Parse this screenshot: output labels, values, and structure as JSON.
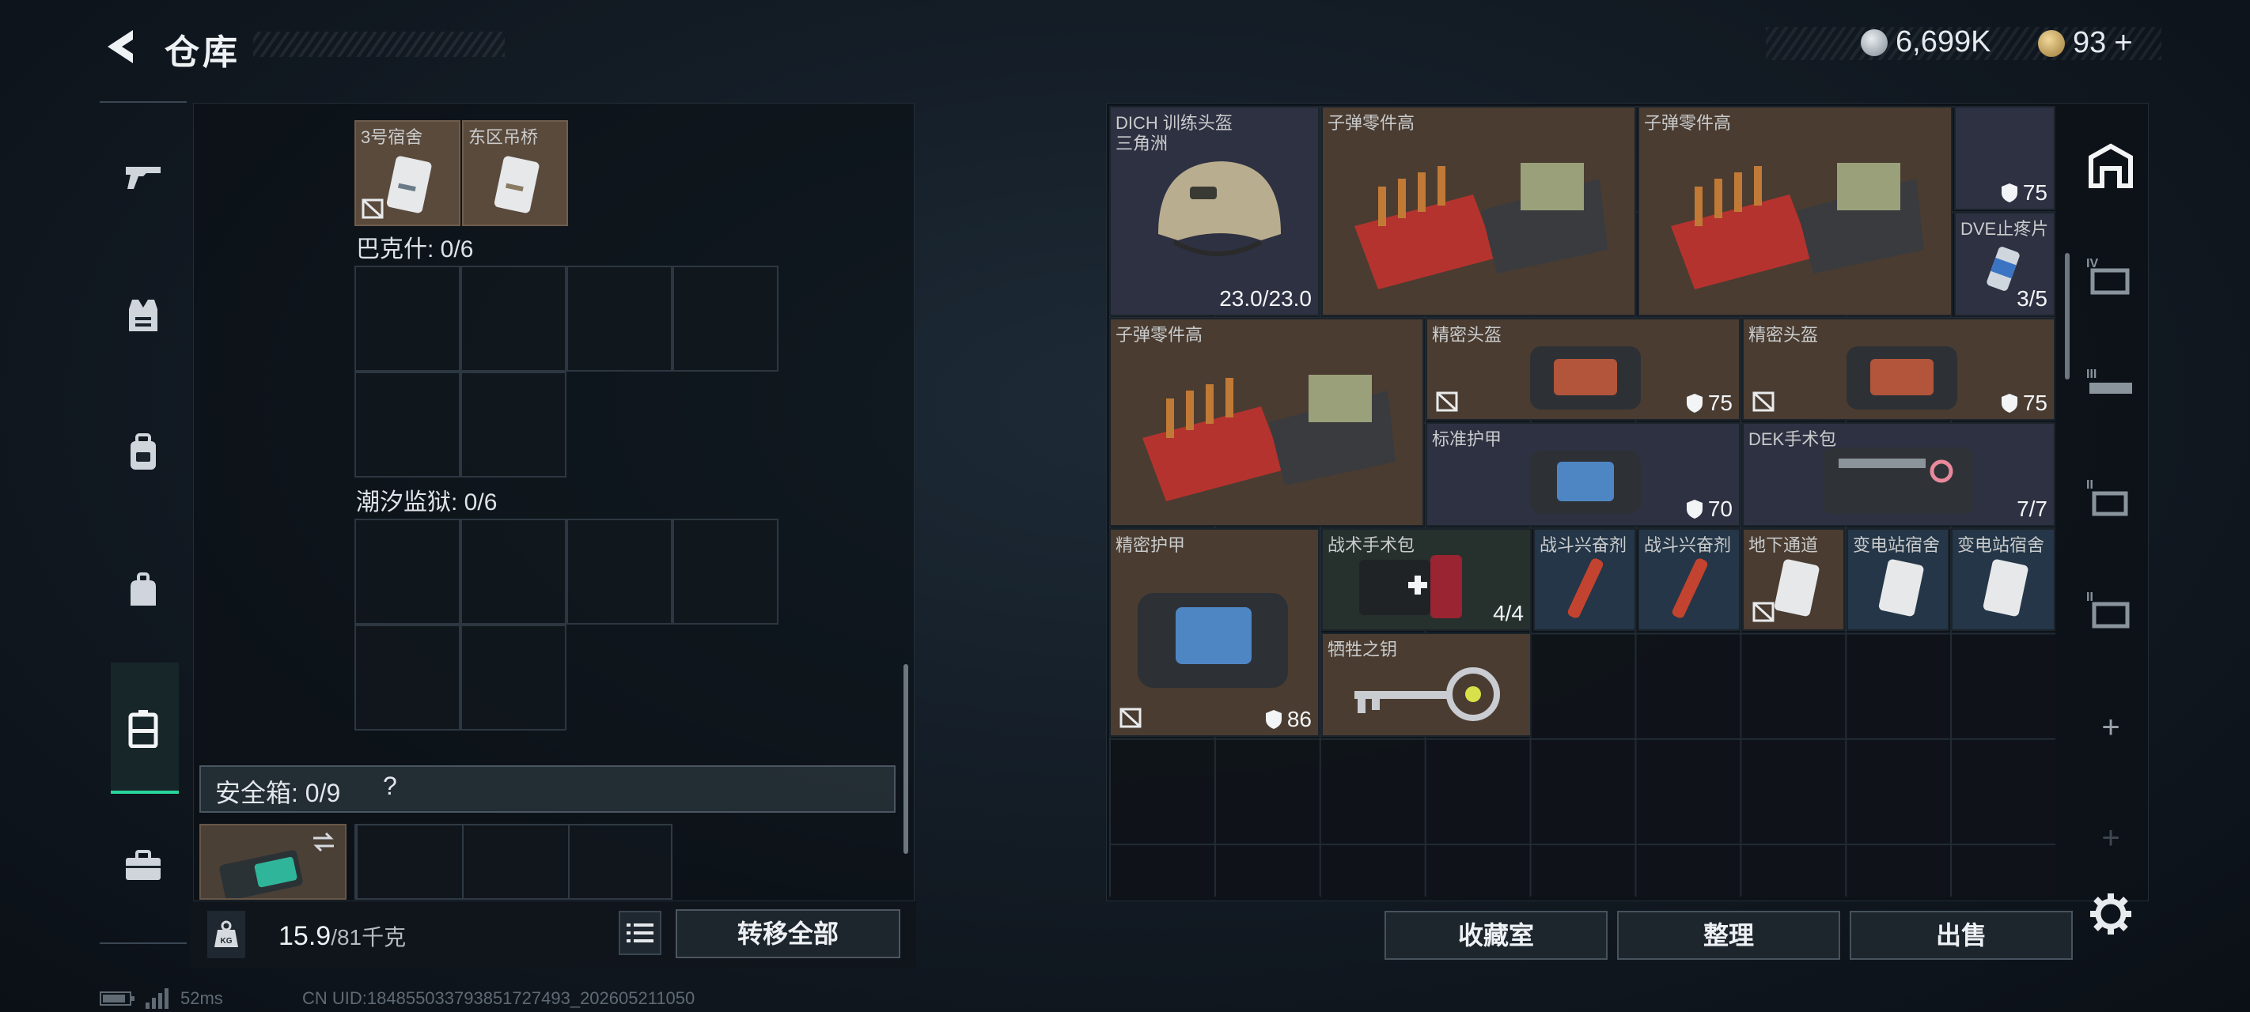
{
  "header": {
    "title": "仓库",
    "currency_main": "6,699K",
    "currency_premium": "93"
  },
  "left_nav": {
    "items": [
      "weapon-icon",
      "armor-vest-icon",
      "backpack-icon",
      "bag-icon",
      "safe-case-icon",
      "toolbox-icon"
    ],
    "active": "safe-case-icon"
  },
  "backpack": {
    "top_items": [
      {
        "name": "3号宿舍"
      },
      {
        "name": "东区吊桥"
      }
    ],
    "section_1": "巴克什: 0/6",
    "section_2": "潮汐监狱: 0/6",
    "safebox_label": "安全箱: 0/9",
    "safebox_help": "?",
    "weight_value": "15.9",
    "weight_cap": "/81千克",
    "transfer_all": "转移全部"
  },
  "storage": {
    "items": [
      {
        "name": "DICH 训练头盔",
        "sub": "三角洲",
        "value": "23.0/23.0"
      },
      {
        "name": "子弹零件高",
        "value": ""
      },
      {
        "name": "子弹零件高",
        "value": ""
      },
      {
        "name": "",
        "value": "75"
      },
      {
        "name": "DVE止疼片",
        "value": "3/5"
      },
      {
        "name": "子弹零件高",
        "value": ""
      },
      {
        "name": "精密头盔",
        "value": "75"
      },
      {
        "name": "精密头盔",
        "value": "75"
      },
      {
        "name": "标准护甲",
        "value": "70"
      },
      {
        "name": "DEK手术包",
        "value": "7/7"
      },
      {
        "name": "精密护甲",
        "value": "86"
      },
      {
        "name": "战术手术包",
        "value": "4/4"
      },
      {
        "name": "战斗兴奋剂",
        "value": ""
      },
      {
        "name": "战斗兴奋剂",
        "value": ""
      },
      {
        "name": "地下通道",
        "value": ""
      },
      {
        "name": "变电站宿舍",
        "value": ""
      },
      {
        "name": "变电站宿舍",
        "value": ""
      },
      {
        "name": "牺牲之钥",
        "value": ""
      }
    ],
    "buttons": {
      "collection": "收藏室",
      "organize": "整理",
      "sell": "出售"
    }
  },
  "status": {
    "ping": "52ms",
    "uid": "CN UID:184855033793851727493_202605211050"
  },
  "colors": {
    "accent_green": "#29d69c",
    "tile_brown": "#4a3c31",
    "tile_slate": "#2e3142"
  }
}
